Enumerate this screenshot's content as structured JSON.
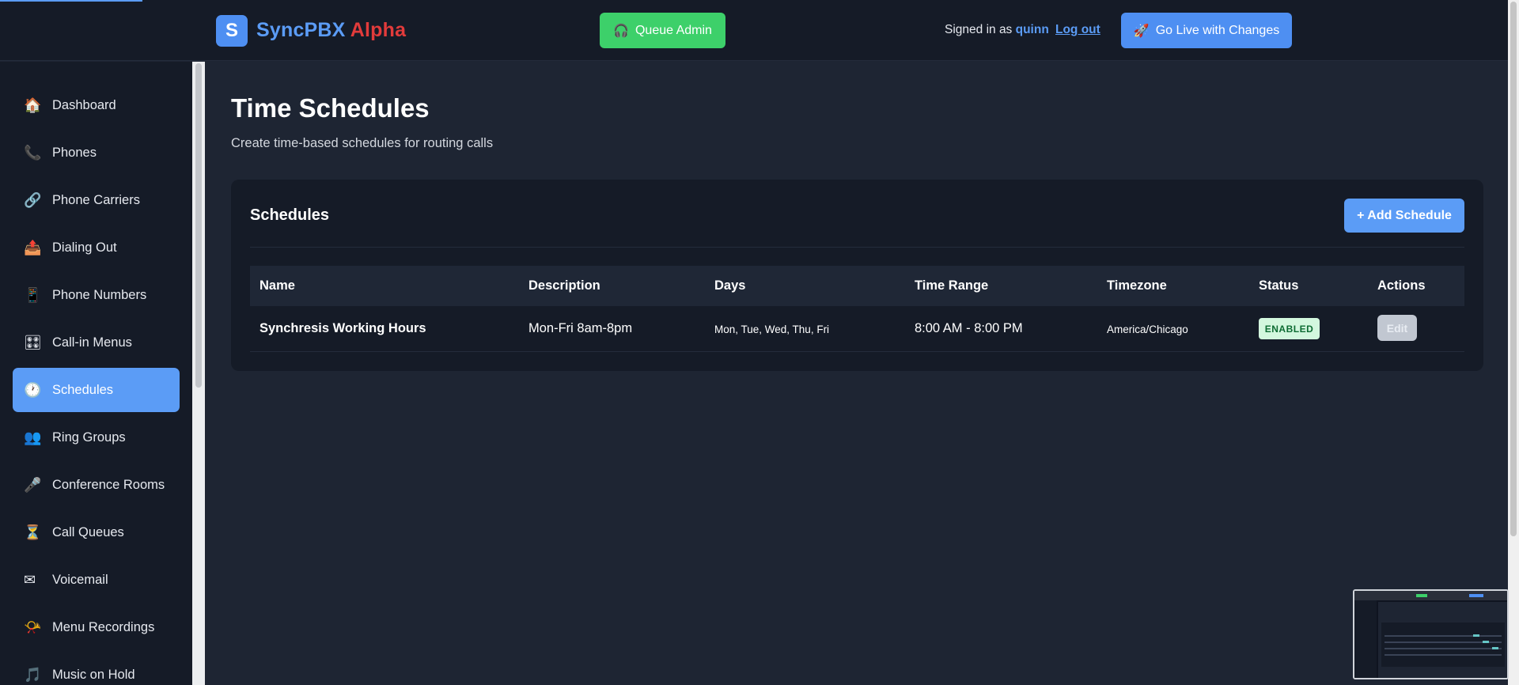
{
  "header": {
    "logo_letter": "S",
    "brand_main": "SyncPBX",
    "brand_suffix": "Alpha",
    "queue_admin_label": "Queue Admin",
    "signed_in_prefix": "Signed in as",
    "username": "quinn",
    "logout_label": "Log out",
    "go_live_label": "Go Live with Changes"
  },
  "sidebar": {
    "items": [
      {
        "label": "Dashboard",
        "icon": "🏠"
      },
      {
        "label": "Phones",
        "icon": "📞"
      },
      {
        "label": "Phone Carriers",
        "icon": "🔗"
      },
      {
        "label": "Dialing Out",
        "icon": "📤"
      },
      {
        "label": "Phone Numbers",
        "icon": "📱"
      },
      {
        "label": "Call-in Menus",
        "icon": "🎛"
      },
      {
        "label": "Schedules",
        "icon": "🕐",
        "active": true
      },
      {
        "label": "Ring Groups",
        "icon": "👥"
      },
      {
        "label": "Conference Rooms",
        "icon": "🎤"
      },
      {
        "label": "Call Queues",
        "icon": "⏳"
      },
      {
        "label": "Voicemail",
        "icon": "✉"
      },
      {
        "label": "Menu Recordings",
        "icon": "📯"
      },
      {
        "label": "Music on Hold",
        "icon": "🎵"
      }
    ]
  },
  "main": {
    "title": "Time Schedules",
    "subtitle": "Create time-based schedules for routing calls",
    "card": {
      "title": "Schedules",
      "add_label": "+ Add Schedule",
      "columns": [
        "Name",
        "Description",
        "Days",
        "Time Range",
        "Timezone",
        "Status",
        "Actions"
      ],
      "rows": [
        {
          "name": "Synchresis Working Hours",
          "description": "Mon-Fri 8am-8pm",
          "days": "Mon, Tue, Wed, Thu, Fri",
          "time_range": "8:00 AM - 8:00 PM",
          "timezone": "America/Chicago",
          "status": "ENABLED",
          "action_label": "Edit"
        }
      ]
    }
  },
  "colors": {
    "accent": "#5b9cf6",
    "brand_alpha": "#e23b3b",
    "queue_green": "#3dd06a",
    "status_enabled_bg": "#d3f7de"
  }
}
